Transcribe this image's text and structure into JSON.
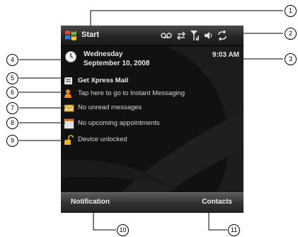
{
  "title_bar": {
    "start_label": "Start",
    "icons": [
      "voicemail-icon",
      "data-sync-icon",
      "signal-strength-icon",
      "volume-icon",
      "connectivity-icon"
    ]
  },
  "today": {
    "day": "Wednesday",
    "date": "September 10, 2008",
    "time": "9:03 AM",
    "items": [
      {
        "label": "Get Xpress Mail",
        "icon": "xpress-mail-icon"
      },
      {
        "label": "Tap here to go to Instant Messaging",
        "icon": "instant-messaging-icon"
      },
      {
        "label": "No unread messages",
        "icon": "messages-envelope-icon"
      },
      {
        "label": "No upcoming appointments",
        "icon": "calendar-icon"
      },
      {
        "label": "Device unlocked",
        "icon": "padlock-icon"
      }
    ]
  },
  "soft_keys": {
    "left": "Notification",
    "right": "Contacts"
  },
  "callouts": [
    "1",
    "2",
    "3",
    "4",
    "5",
    "6",
    "7",
    "8",
    "9",
    "10",
    "11"
  ]
}
